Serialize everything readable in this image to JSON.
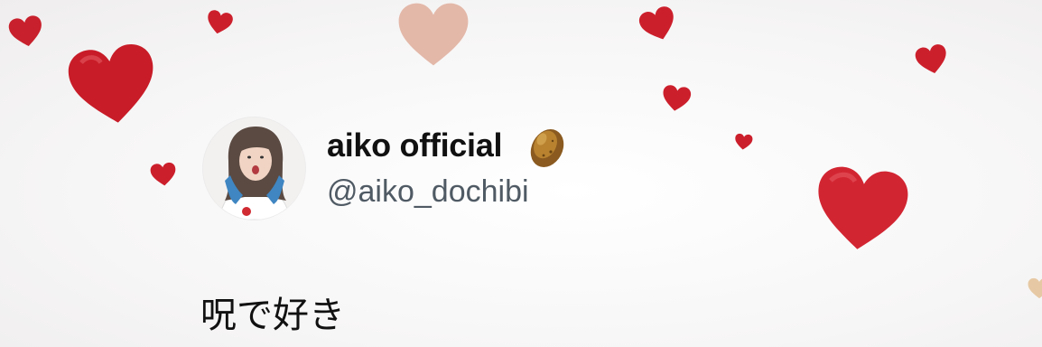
{
  "profile": {
    "display_name": "aiko official",
    "name_emoji_icon": "potato-icon",
    "handle": "@aiko_dochibi",
    "bio": "呪で好き"
  },
  "colors": {
    "heart_red": "#cc1f2c",
    "heart_pink": "#e2b7a8",
    "text": "#111111",
    "handle_text": "#4f5a64"
  }
}
